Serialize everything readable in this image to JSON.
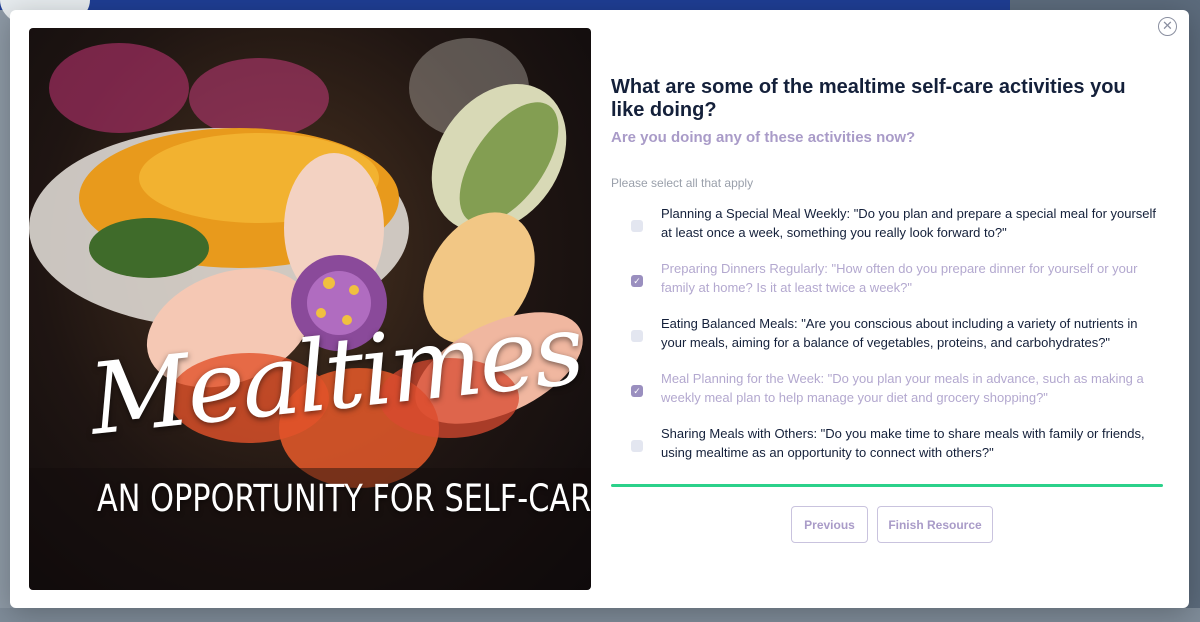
{
  "modal": {
    "close_icon": "close-icon",
    "hero": {
      "script_title": "Mealtimes",
      "tagline": "AN OPPORTUNITY FOR SELF-CARE"
    },
    "question": "What are some of the mealtime self-care activities you like doing?",
    "subquestion": "Are you doing any of these activities now?",
    "instruction": "Please select all that apply",
    "options": [
      {
        "label": "Planning a Special Meal Weekly: \"Do you plan and prepare a special meal for yourself at least once a week, something you really look forward to?\"",
        "checked": false
      },
      {
        "label": "Preparing Dinners Regularly: \"How often do you prepare dinner for yourself or your family at home? Is it at least twice a week?\"",
        "checked": true
      },
      {
        "label": "Eating Balanced Meals: \"Are you conscious about including a variety of nutrients in your meals, aiming for a balance of vegetables, proteins, and carbohydrates?\"",
        "checked": false
      },
      {
        "label": "Meal Planning for the Week: \"Do you plan your meals in advance, such as making a weekly meal plan to help manage your diet and grocery shopping?\"",
        "checked": true
      },
      {
        "label": "Sharing Meals with Others: \"Do you make time to share meals with family or friends, using mealtime as an opportunity to connect with others?\"",
        "checked": false
      }
    ],
    "progress": 1.0,
    "buttons": {
      "previous": "Previous",
      "finish": "Finish Resource"
    },
    "colors": {
      "accent_purple": "#a99bc8",
      "progress_green": "#2bd18a",
      "heading": "#14203a"
    }
  }
}
